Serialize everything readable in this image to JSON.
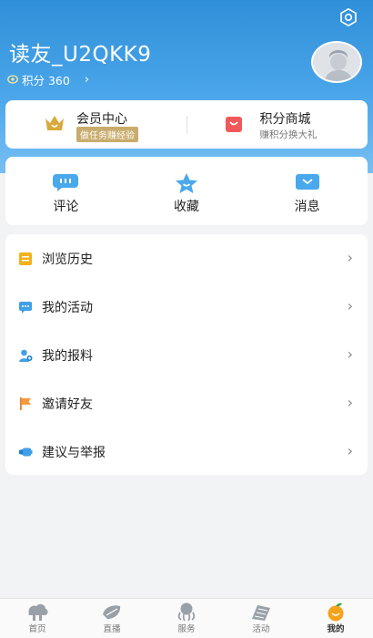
{
  "header": {
    "username": "读友_U2QKK9",
    "points_label": "积分 360",
    "points_arrow": "›"
  },
  "vip": {
    "title": "会员中心",
    "tag": "做任务赚经验"
  },
  "shop": {
    "title": "积分商城",
    "subtitle": "赚积分换大礼"
  },
  "quick_actions": [
    {
      "label": "评论",
      "icon": "comment-icon"
    },
    {
      "label": "收藏",
      "icon": "star-icon"
    },
    {
      "label": "消息",
      "icon": "message-icon"
    }
  ],
  "menu": [
    {
      "label": "浏览历史",
      "icon": "history-icon",
      "chevron": "›"
    },
    {
      "label": "我的活动",
      "icon": "activity-icon",
      "chevron": "›"
    },
    {
      "label": "我的报料",
      "icon": "report-news-icon",
      "chevron": "›"
    },
    {
      "label": "邀请好友",
      "icon": "flag-icon",
      "chevron": "›"
    },
    {
      "label": "建议与举报",
      "icon": "feedback-icon",
      "chevron": "›"
    }
  ],
  "tabs": [
    {
      "label": "首页",
      "icon": "home-icon",
      "active": false
    },
    {
      "label": "直播",
      "icon": "live-icon",
      "active": false
    },
    {
      "label": "服务",
      "icon": "service-icon",
      "active": false
    },
    {
      "label": "活动",
      "icon": "event-icon",
      "active": false
    },
    {
      "label": "我的",
      "icon": "orange-icon",
      "active": true
    }
  ],
  "colors": {
    "header_top": "#2f8fd8",
    "header_bottom": "#77bff2",
    "vip_gold": "#c9ac6d",
    "shop_red": "#f0585a",
    "quick_blue": "#4aa8ec",
    "active_orange": "#f7a21b"
  }
}
